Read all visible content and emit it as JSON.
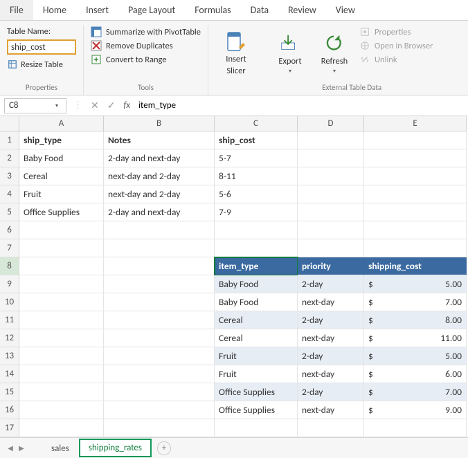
{
  "menu": {
    "items": [
      "File",
      "Home",
      "Insert",
      "Page Layout",
      "Formulas",
      "Data",
      "Review",
      "View"
    ]
  },
  "ribbon": {
    "properties": {
      "label": "Properties",
      "table_name_label": "Table Name:",
      "table_name_value": "ship_cost",
      "resize_label": "Resize Table"
    },
    "tools": {
      "label": "Tools",
      "summarize": "Summarize with PivotTable",
      "remove_dup": "Remove Duplicates",
      "convert": "Convert to Range"
    },
    "slicer": {
      "top": "Insert",
      "bottom": "Slicer"
    },
    "export": "Export",
    "refresh": "Refresh",
    "extdata": {
      "label": "External Table Data",
      "props": "Properties",
      "browser": "Open in Browser",
      "unlink": "Unlink"
    }
  },
  "fx": {
    "namebox": "C8",
    "formula": "item_type",
    "fx_label": "fx"
  },
  "grid": {
    "cols": [
      "A",
      "B",
      "C",
      "D",
      "E"
    ],
    "data_region": {
      "headers": [
        "ship_type",
        "Notes",
        "ship_cost"
      ],
      "rows": [
        [
          "Baby Food",
          "2-day and next-day",
          "5-7"
        ],
        [
          "Cereal",
          "next-day and 2-day",
          " 8-11"
        ],
        [
          "Fruit",
          "next-day and 2-day",
          "5-6"
        ],
        [
          "Office Supplies",
          "2-day and next-day",
          " 7-9"
        ]
      ]
    },
    "table_region": {
      "headers": [
        "item_type",
        "priority",
        "shipping_cost"
      ],
      "rows": [
        {
          "item": "Baby Food",
          "priority": "2-day",
          "currency": "$",
          "cost": "5.00"
        },
        {
          "item": "Baby Food",
          "priority": "next-day",
          "currency": "$",
          "cost": "7.00"
        },
        {
          "item": "Cereal",
          "priority": "2-day",
          "currency": "$",
          "cost": "8.00"
        },
        {
          "item": "Cereal",
          "priority": "next-day",
          "currency": "$",
          "cost": "11.00"
        },
        {
          "item": "Fruit",
          "priority": "2-day",
          "currency": "$",
          "cost": "5.00"
        },
        {
          "item": "Fruit",
          "priority": "next-day",
          "currency": "$",
          "cost": "6.00"
        },
        {
          "item": "Office Supplies",
          "priority": "2-day",
          "currency": "$",
          "cost": "7.00"
        },
        {
          "item": "Office Supplies",
          "priority": "next-day",
          "currency": "$",
          "cost": "9.00"
        }
      ]
    },
    "row_numbers": [
      1,
      2,
      3,
      4,
      5,
      6,
      7,
      8,
      9,
      10,
      11,
      12,
      13,
      14,
      15,
      16,
      17
    ]
  },
  "sheets": {
    "tabs": [
      "sales",
      "shipping_rates"
    ],
    "active": 1,
    "add": "+"
  }
}
